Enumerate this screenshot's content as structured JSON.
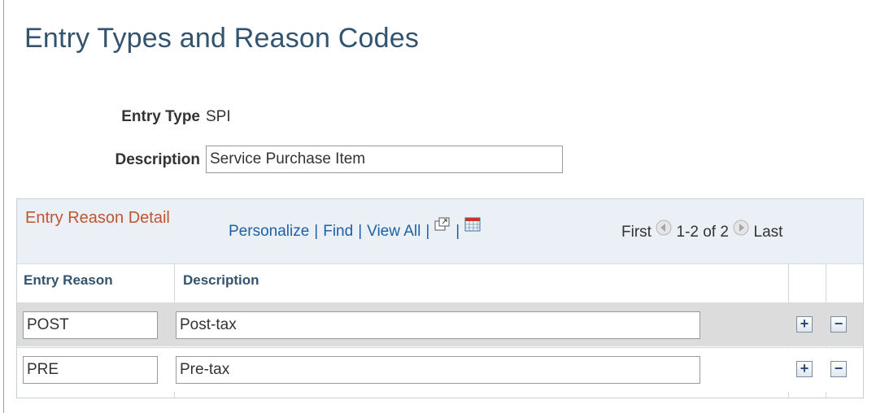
{
  "page": {
    "title": "Entry Types and Reason Codes"
  },
  "form": {
    "entry_type_label": "Entry Type",
    "entry_type_value": "SPI",
    "description_label": "Description",
    "description_value": "Service Purchase Item"
  },
  "grid": {
    "title": "Entry Reason Detail",
    "toolbar": {
      "personalize": "Personalize",
      "separator": "|",
      "find": "Find",
      "view_all": "View All",
      "first": "First",
      "range": "1-2 of 2",
      "last": "Last"
    },
    "columns": [
      "Entry Reason",
      "Description"
    ],
    "rows": [
      {
        "entry_reason": "POST",
        "description": "Post-tax"
      },
      {
        "entry_reason": "PRE",
        "description": "Pre-tax"
      }
    ],
    "add_label": "+",
    "delete_label": "−"
  },
  "icons": {
    "zoom": "new-window-icon",
    "download": "spreadsheet-icon",
    "prev": "prev-arrow-icon",
    "next": "next-arrow-icon"
  },
  "colors": {
    "title": "#32546e",
    "grid_title": "#c0552f",
    "link": "#1f5fa6",
    "header_bg": "#eaf0f5",
    "odd_row": "#dcdcdc"
  }
}
